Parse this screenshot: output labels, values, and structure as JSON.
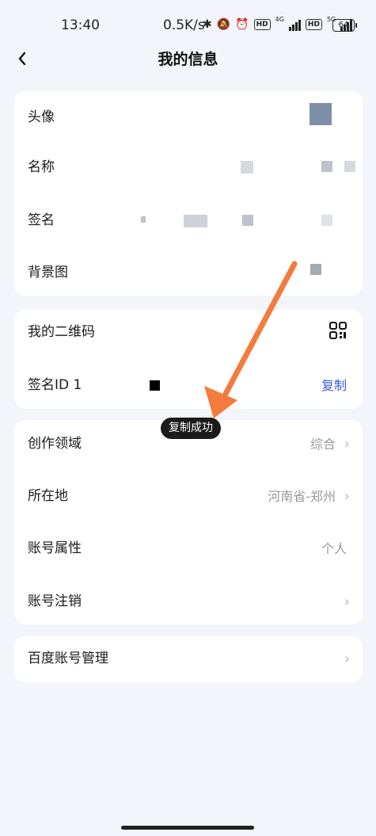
{
  "status_bar": {
    "time": "13:40",
    "network_speed": "0.5K/s",
    "hd1": "HD",
    "net1": "4G",
    "hd2": "HD",
    "net2": "5G",
    "battery": "64"
  },
  "header": {
    "back_icon": "chevron-left-icon",
    "title": "我的信息"
  },
  "profile_card": {
    "avatar_label": "头像",
    "name_label": "名称",
    "signature_label": "签名",
    "background_label": "背景图"
  },
  "id_card": {
    "qr_label": "我的二维码",
    "sign_id_label": "签名ID 1",
    "copy_label": "复制"
  },
  "toast": "复制成功",
  "info_card": {
    "domain_label": "创作领域",
    "domain_value": "综合",
    "location_label": "所在地",
    "location_value": "河南省-郑州",
    "account_type_label": "账号属性",
    "account_type_value": "个人",
    "cancel_label": "账号注销"
  },
  "baidu_card": {
    "manage_label": "百度账号管理"
  },
  "colors": {
    "accent_link": "#3b5bdb",
    "annotation_arrow": "#f47b3c",
    "page_bg": "#f3f5fa"
  }
}
